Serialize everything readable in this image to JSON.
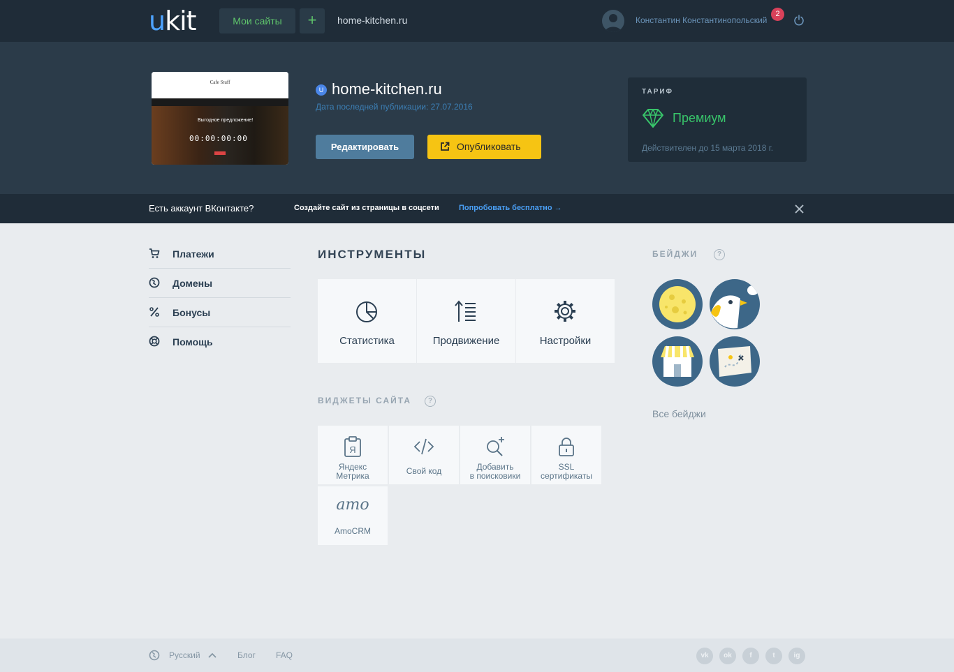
{
  "topbar": {
    "logo_u": "u",
    "logo_rest": "kit",
    "my_sites": "Мои сайты",
    "add": "+",
    "domain": "home-kitchen.ru",
    "user_name": "Константин Константинопольский",
    "notifications": "2"
  },
  "hero": {
    "thumb": {
      "title": "Cafe Stuff",
      "offer": "Выгодное предложение!",
      "timer": "00:00:00:00"
    },
    "site_badge": "U",
    "site_title": "home-kitchen.ru",
    "last_published": "Дата последней публикации: 27.07.2016",
    "edit_button": "Редактировать",
    "publish_button": "Опубликовать",
    "tariff": {
      "label": "ТАРИФ",
      "name": "Премиум",
      "valid_until": "Действителен до 15 марта 2018 г."
    }
  },
  "vkbar": {
    "question": "Есть аккаунт ВКонтакте?",
    "create": "Создайте сайт из страницы в соцсети",
    "try": "Попробовать бесплатно →"
  },
  "sidebar": {
    "items": [
      {
        "label": "Платежи",
        "icon": "cart-icon"
      },
      {
        "label": "Домены",
        "icon": "globe-icon"
      },
      {
        "label": "Бонусы",
        "icon": "percent-icon"
      },
      {
        "label": "Помощь",
        "icon": "lifebuoy-icon"
      }
    ]
  },
  "tools": {
    "heading": "ИНСТРУМЕНТЫ",
    "items": [
      {
        "label": "Статистика",
        "icon": "pie-chart-icon"
      },
      {
        "label": "Продвижение",
        "icon": "sort-arrow-icon"
      },
      {
        "label": "Настройки",
        "icon": "gear-icon"
      }
    ]
  },
  "widgets": {
    "heading": "ВИДЖЕТЫ САЙТА",
    "help": "?",
    "items": [
      {
        "line1": "Яндекс",
        "line2": "Метрика",
        "icon": "yandex-metrika-icon"
      },
      {
        "line1": "Свой код",
        "line2": "",
        "icon": "code-icon"
      },
      {
        "line1": "Добавить",
        "line2": "в поисковики",
        "icon": "search-add-icon"
      },
      {
        "line1": "SSL",
        "line2": "сертификаты",
        "icon": "lock-icon"
      },
      {
        "line1": "AmoCRM",
        "line2": "",
        "icon": "amo-logo"
      }
    ],
    "amo_logo_text": "amo"
  },
  "badges": {
    "heading": "БЕЙДЖИ",
    "help": "?",
    "all": "Все бейджи"
  },
  "footer": {
    "language": "Русский",
    "blog": "Блог",
    "faq": "FAQ",
    "social": [
      "vk",
      "ok",
      "f",
      "t",
      "ig"
    ]
  },
  "colors": {
    "topbar": "#1f2c38",
    "hero": "#2b3b49",
    "accent_green": "#38c46a",
    "accent_yellow": "#f6c413",
    "link_blue": "#4a9ff5",
    "page_bg": "#e9ecef"
  }
}
